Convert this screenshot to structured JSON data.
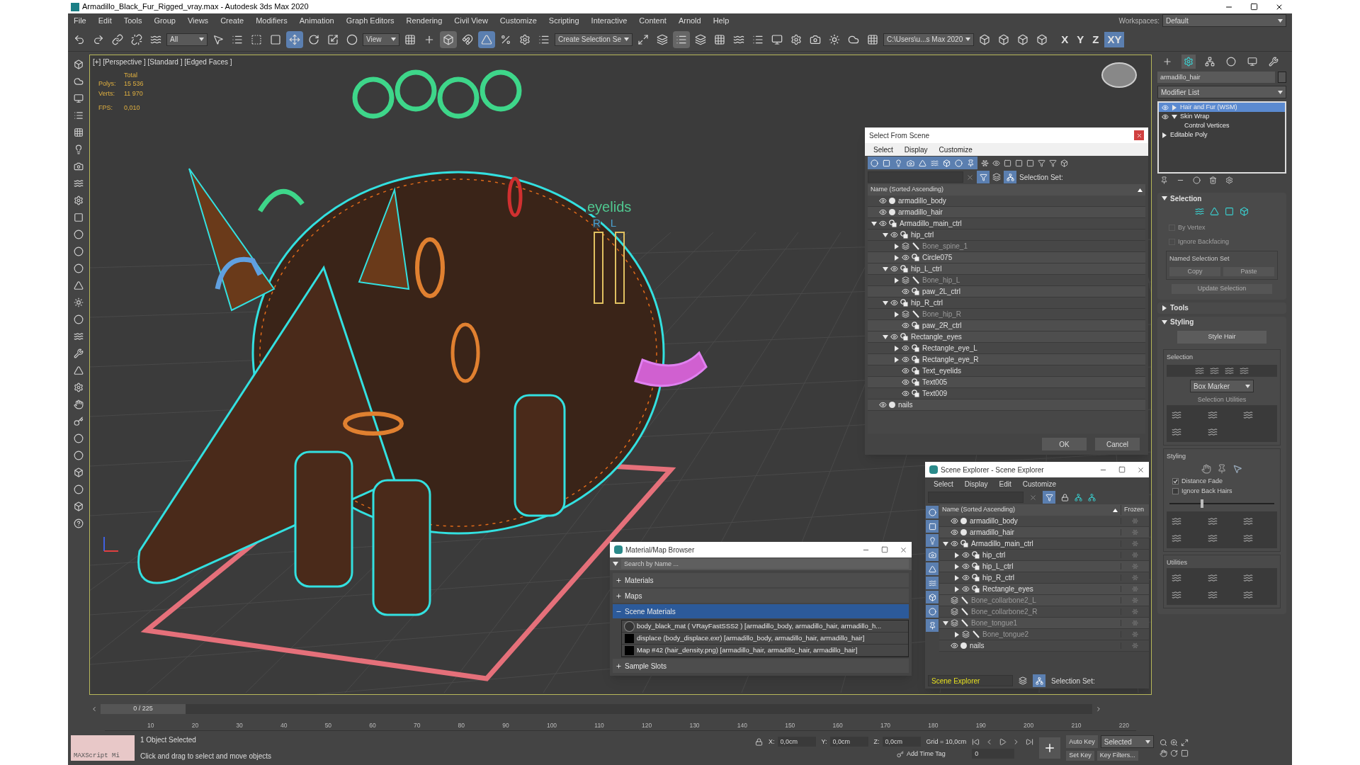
{
  "window": {
    "title": "Armadillo_Black_Fur_Rigged_vray.max - Autodesk 3ds Max 2020"
  },
  "menu": [
    "File",
    "Edit",
    "Tools",
    "Group",
    "Views",
    "Create",
    "Modifiers",
    "Animation",
    "Graph Editors",
    "Rendering",
    "Civil View",
    "Customize",
    "Scripting",
    "Interactive",
    "Content",
    "Arnold",
    "Help"
  ],
  "workspace": {
    "label": "Workspaces:",
    "value": "Default"
  },
  "toolbar": {
    "filter": "All",
    "view": "View",
    "selection_set": "Create Selection Se",
    "project_path": "C:\\Users\\u...s Max 2020",
    "axes": [
      {
        "label": "X",
        "selected": false
      },
      {
        "label": "Y",
        "selected": false
      },
      {
        "label": "Z",
        "selected": false
      },
      {
        "label": "XY",
        "selected": true
      }
    ]
  },
  "viewport": {
    "label": "[+] [Perspective ] [Standard ] [Edged Faces ]",
    "total": "Total",
    "stats": [
      {
        "label": "Polys:",
        "value": "15 536"
      },
      {
        "label": "Verts:",
        "value": "11 970"
      }
    ],
    "fps": {
      "label": "FPS:",
      "value": "0,010"
    },
    "scene_text": "eyelids",
    "scene_letters": [
      "R",
      "L"
    ]
  },
  "select_from_scene": {
    "title": "Select From Scene",
    "menu": [
      "Select",
      "Display",
      "Customize"
    ],
    "selection_set_label": "Selection Set:",
    "column": "Name (Sorted Ascending)",
    "rows": [
      {
        "name": "armadillo_body",
        "kind": "geometry"
      },
      {
        "name": "armadillo_hair",
        "kind": "geometry"
      },
      {
        "name": "Armadillo_main_ctrl",
        "kind": "shape",
        "expanded": true,
        "children": [
          {
            "name": "hip_ctrl",
            "kind": "shape",
            "expanded": true,
            "children": [
              {
                "name": "Bone_spine_1",
                "kind": "bone",
                "expanded": false
              },
              {
                "name": "Circle075",
                "kind": "shape",
                "expanded": false
              }
            ]
          },
          {
            "name": "hip_L_ctrl",
            "kind": "shape",
            "expanded": true,
            "children": [
              {
                "name": "Bone_hip_L",
                "kind": "bone",
                "expanded": false
              },
              {
                "name": "paw_2L_ctrl",
                "kind": "shape"
              }
            ]
          },
          {
            "name": "hip_R_ctrl",
            "kind": "shape",
            "expanded": true,
            "children": [
              {
                "name": "Bone_hip_R",
                "kind": "bone",
                "expanded": false
              },
              {
                "name": "paw_2R_ctrl",
                "kind": "shape"
              }
            ]
          },
          {
            "name": "Rectangle_eyes",
            "kind": "shape",
            "expanded": true,
            "children": [
              {
                "name": "Rectangle_eye_L",
                "kind": "shape",
                "expanded": false
              },
              {
                "name": "Rectangle_eye_R",
                "kind": "shape",
                "expanded": false
              },
              {
                "name": "Text_eyelids",
                "kind": "shape"
              },
              {
                "name": "Text005",
                "kind": "shape"
              },
              {
                "name": "Text009",
                "kind": "shape"
              }
            ]
          }
        ]
      },
      {
        "name": "nails",
        "kind": "geometry"
      }
    ],
    "buttons": [
      "OK",
      "Cancel"
    ]
  },
  "scene_explorer": {
    "title": "Scene Explorer - Scene Explorer",
    "menu": [
      "Select",
      "Display",
      "Edit",
      "Customize"
    ],
    "column": "Name (Sorted Ascending)",
    "frozen_column": "Frozen",
    "explorer": "Scene Explorer",
    "selection_set_label": "Selection Set:",
    "rows": [
      {
        "name": "armadillo_body",
        "kind": "geometry"
      },
      {
        "name": "armadillo_hair",
        "kind": "geometry"
      },
      {
        "name": "Armadillo_main_ctrl",
        "kind": "shape",
        "expanded": true,
        "children": [
          {
            "name": "hip_ctrl",
            "kind": "shape",
            "expanded": false
          },
          {
            "name": "hip_L_ctrl",
            "kind": "shape",
            "expanded": false
          },
          {
            "name": "hip_R_ctrl",
            "kind": "shape",
            "expanded": false
          },
          {
            "name": "Rectangle_eyes",
            "kind": "shape",
            "expanded": false
          }
        ]
      },
      {
        "name": "Bone_collarbone2_L",
        "kind": "bone"
      },
      {
        "name": "Bone_collarbone2_R",
        "kind": "bone"
      },
      {
        "name": "Bone_tongue1",
        "kind": "bone",
        "expanded": true,
        "children": [
          {
            "name": "Bone_tongue2",
            "kind": "bone",
            "expanded": false
          }
        ]
      },
      {
        "name": "nails",
        "kind": "geometry"
      }
    ]
  },
  "material_browser": {
    "title": "Material/Map Browser",
    "placeholder": "Search by Name ...",
    "groups": [
      {
        "label": "Materials",
        "expanded": false
      },
      {
        "label": "Maps",
        "expanded": false
      },
      {
        "label": "Scene Materials",
        "expanded": true,
        "items": [
          {
            "text": "body_black_mat ( VRayFastSSS2 ) [armadillo_body, armadillo_hair, armadillo_h...",
            "kind": "material"
          },
          {
            "text": "displace (body_displace.exr) [armadillo_body, armadillo_hair, armadillo_hair]",
            "kind": "map"
          },
          {
            "text": "Map #42 (hair_density.png) [armadillo_hair, armadillo_hair, armadillo_hair]",
            "kind": "map"
          }
        ]
      },
      {
        "label": "Sample Slots",
        "expanded": false
      }
    ]
  },
  "command_panel": {
    "tabs": [
      {
        "kind": "create",
        "selected": false
      },
      {
        "kind": "modify",
        "selected": true
      },
      {
        "kind": "hierarchy",
        "selected": false
      },
      {
        "kind": "motion",
        "selected": false
      },
      {
        "kind": "display",
        "selected": false
      },
      {
        "kind": "utilities",
        "selected": false
      }
    ],
    "object_name": "armadillo_hair",
    "modifier_list": "Modifier List",
    "stack": [
      {
        "label": "Hair and Fur (WSM)",
        "selected": true,
        "expanded": false
      },
      {
        "label": "Skin Wrap",
        "selected": false,
        "expanded": true,
        "children": [
          {
            "label": "Control Vertices",
            "selected": false
          }
        ]
      },
      {
        "label": "Editable Poly",
        "selected": false,
        "expanded": false
      }
    ],
    "rollouts": [
      {
        "title": "Selection",
        "expanded": true,
        "kind": "selection",
        "checkboxes": [
          {
            "label": "By Vertex",
            "checked": false,
            "disabled": true
          },
          {
            "label": "Ignore Backfacing",
            "checked": false,
            "disabled": true
          }
        ],
        "group": "Named Selection Set",
        "buttons": [
          "Copy",
          "Paste"
        ],
        "update": "Update Selection"
      },
      {
        "title": "Tools",
        "expanded": false,
        "kind": "plain"
      },
      {
        "title": "Styling",
        "expanded": true,
        "kind": "styling",
        "style_button": "Style Hair",
        "selection_group": "Selection",
        "marker": "Box Marker",
        "utilities_label": "Selection Utilities",
        "styling_group": "Styling",
        "checkboxes": [
          {
            "label": "Distance Fade",
            "checked": true,
            "disabled": false
          },
          {
            "label": "Ignore Back Hairs",
            "checked": false,
            "disabled": false
          }
        ],
        "slider": {
          "level": 0.3
        },
        "utilities_group": "Utilities"
      }
    ]
  },
  "timeline": {
    "frame": "0 / 225",
    "ticks": [
      "10",
      "20",
      "30",
      "40",
      "50",
      "60",
      "70",
      "80",
      "90",
      "100",
      "110",
      "120",
      "130",
      "140",
      "150",
      "160",
      "170",
      "180",
      "190",
      "200",
      "210",
      "220"
    ]
  },
  "status": {
    "maxscript": "MAXScript Mi",
    "selected": "1 Object Selected",
    "prompt": "Click and drag to select and move objects",
    "coords": [
      {
        "label": "X:",
        "value": "0,0cm"
      },
      {
        "label": "Y:",
        "value": "0,0cm"
      },
      {
        "label": "Z:",
        "value": "0,0cm"
      }
    ],
    "grid": "Grid = 10,0cm",
    "time_tag": "Add Time Tag",
    "auto_key": "Auto Key",
    "key_mode": "Selected",
    "set_key": "Set Key",
    "key_filters": "Key Filters...",
    "current_frame": "0"
  }
}
